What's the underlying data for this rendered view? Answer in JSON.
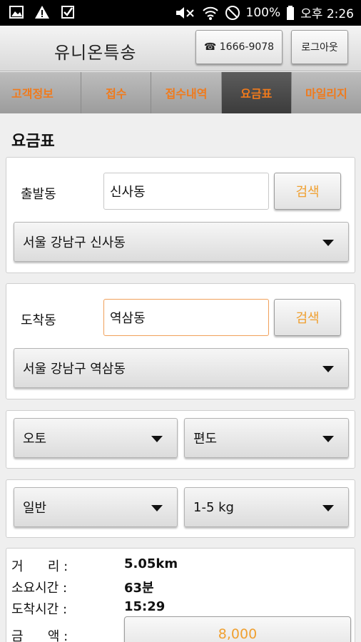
{
  "status_bar": {
    "battery": "100%",
    "time": "오후 2:26",
    "icons": [
      "gallery-icon",
      "warning-icon",
      "checkbox-icon",
      "mute-icon",
      "wifi-icon",
      "no-signal-icon",
      "battery-icon"
    ]
  },
  "header": {
    "title": "유니온특송",
    "phone_label": "☎ 1666-9078",
    "logout_label": "로그아웃"
  },
  "tabs": [
    {
      "label": "고객정보",
      "active": false
    },
    {
      "label": "접수",
      "active": false
    },
    {
      "label": "접수내역",
      "active": false
    },
    {
      "label": "요금표",
      "active": true
    },
    {
      "label": "마일리지",
      "active": false
    }
  ],
  "page": {
    "title": "요금표"
  },
  "departure": {
    "label": "출발동",
    "value": "신사동",
    "search_label": "검색",
    "selected_address": "서울 강남구 신사동"
  },
  "arrival": {
    "label": "도착동",
    "value": "역삼동",
    "search_label": "검색",
    "selected_address": "서울 강남구 역삼동"
  },
  "options": {
    "vehicle": "오토",
    "trip": "편도",
    "service": "일반",
    "weight": "1-5 kg"
  },
  "result": {
    "distance_label": "거      리 :",
    "distance_value": "5.05km",
    "duration_label": "소요시간 :",
    "duration_value": "63분",
    "arrival_time_label": "도착시간 :",
    "arrival_time_value": "15:29",
    "amount_label": "금      액 :",
    "amount_value": "8,000"
  },
  "colors": {
    "accent": "#f07a1c",
    "button_text": "#f0a030",
    "active_tab_bg": "#4a4a4a"
  }
}
